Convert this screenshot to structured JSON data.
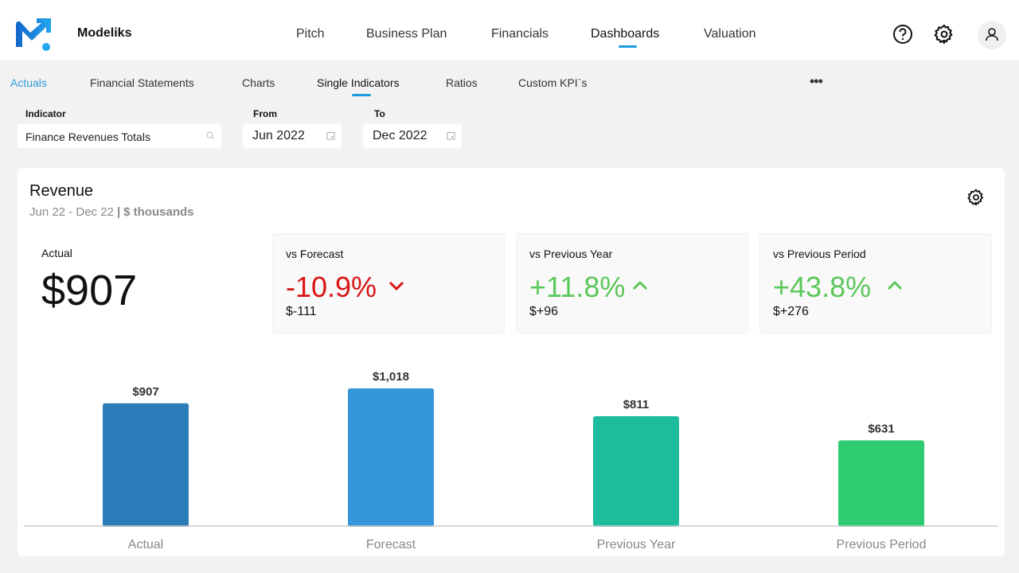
{
  "header": {
    "brand": "Modeliks",
    "nav": [
      "Pitch",
      "Business Plan",
      "Financials",
      "Dashboards",
      "Valuation"
    ],
    "active_nav": "Dashboards"
  },
  "subtabs": [
    "Actuals",
    "Financial Statements",
    "Charts",
    "Single Indicators",
    "Ratios",
    "Custom KPI`s"
  ],
  "filters": {
    "indicator_label": "Indicator",
    "indicator_value": "Finance Revenues Totals",
    "from_label": "From",
    "from_value": "Jun 2022",
    "to_label": "To",
    "to_value": "Dec 2022"
  },
  "card": {
    "title": "Revenue",
    "period": "Jun 22 - Dec 22",
    "unit": "$ thousands",
    "actual_label": "Actual",
    "actual_value": "$907",
    "kpis": [
      {
        "label": "vs Forecast",
        "pct": "-10.9%",
        "delta": "$-111",
        "direction": "down",
        "color": "#d81515"
      },
      {
        "label": "vs Previous Year",
        "pct": "+11.8%",
        "delta": "$+96",
        "direction": "up",
        "color": "#5cc75a"
      },
      {
        "label": "vs Previous Period",
        "pct": "+43.8%",
        "delta": "$+276",
        "direction": "up",
        "color": "#5cc75a"
      }
    ]
  },
  "chart_data": {
    "type": "bar",
    "title": "",
    "xlabel": "",
    "ylabel": "",
    "ylim": [
      0,
      1100
    ],
    "categories": [
      "Actual",
      "Forecast",
      "Previous Year",
      "Previous Period"
    ],
    "values": [
      907,
      1018,
      811,
      631
    ],
    "labels": [
      "$907",
      "$1,018",
      "$811",
      "$631"
    ],
    "colors": [
      "#2a7db8",
      "#3597da",
      "#1dbc9c",
      "#2ecc71"
    ]
  }
}
